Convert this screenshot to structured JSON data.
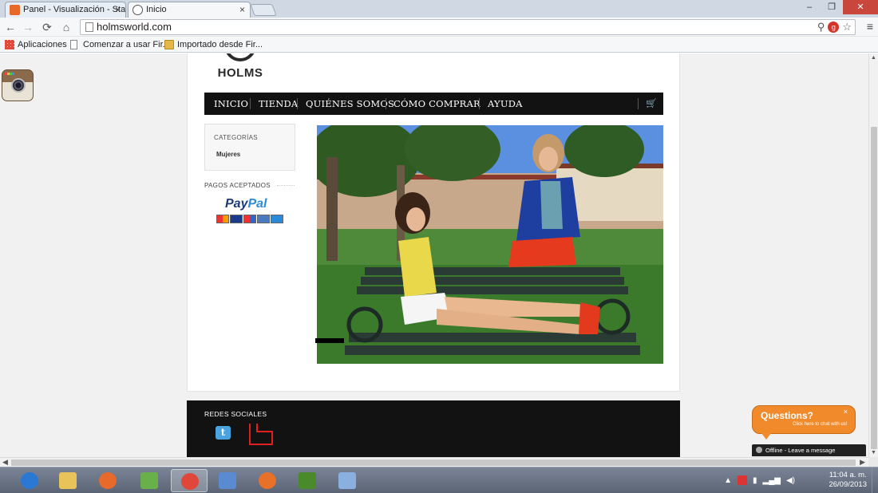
{
  "browser": {
    "tabs": [
      {
        "title": "Panel - Visualización - Sta"
      },
      {
        "title": "Inicio"
      }
    ],
    "url": "holmsworld.com",
    "bookmarks": [
      {
        "label": "Aplicaciones",
        "icon": "apps-grid-icon"
      },
      {
        "label": "Comenzar a usar Fir...",
        "icon": "document-icon"
      },
      {
        "label": "Importado desde Fir...",
        "icon": "folder-icon"
      }
    ]
  },
  "site": {
    "logo_text": "HOLMS",
    "nav": [
      "INICIO",
      "TIENDA",
      "QUIÉNES SOMOS",
      "CÓMO COMPRAR",
      "AYUDA"
    ],
    "sidebar": {
      "categories_title": "CATEGORÍAS",
      "categories": [
        "Mujeres"
      ],
      "payments_title": "PAGOS ACEPTADOS",
      "paypal_text_1": "Pay",
      "paypal_text_2": "Pal"
    },
    "footer": {
      "social_title": "REDES SOCIALES",
      "twitter_glyph": "t"
    }
  },
  "chat": {
    "title": "Questions?",
    "subtitle": "Click here to chat with us!",
    "close": "×",
    "status": "Offline - Leave a message"
  },
  "taskbar": {
    "apps": [
      {
        "name": "internet-explorer",
        "color": "#2a78d4"
      },
      {
        "name": "file-explorer",
        "color": "#e8c35a"
      },
      {
        "name": "paint-app",
        "color": "#e86a2a"
      },
      {
        "name": "webs-app",
        "color": "#6ab04a"
      },
      {
        "name": "chrome",
        "color": "#e0463a"
      },
      {
        "name": "remote-desktop",
        "color": "#5a8ad0"
      },
      {
        "name": "firefox",
        "color": "#e8712a"
      },
      {
        "name": "dreamweaver",
        "color": "#4a8a2a"
      },
      {
        "name": "virtualbox",
        "color": "#8ab0e0"
      }
    ],
    "time": "11:04 a. m.",
    "date": "26/09/2013"
  },
  "colors": {
    "nav_bg": "#121212",
    "chat_orange": "#f08a2b",
    "twitter_blue": "#4aa3df"
  }
}
